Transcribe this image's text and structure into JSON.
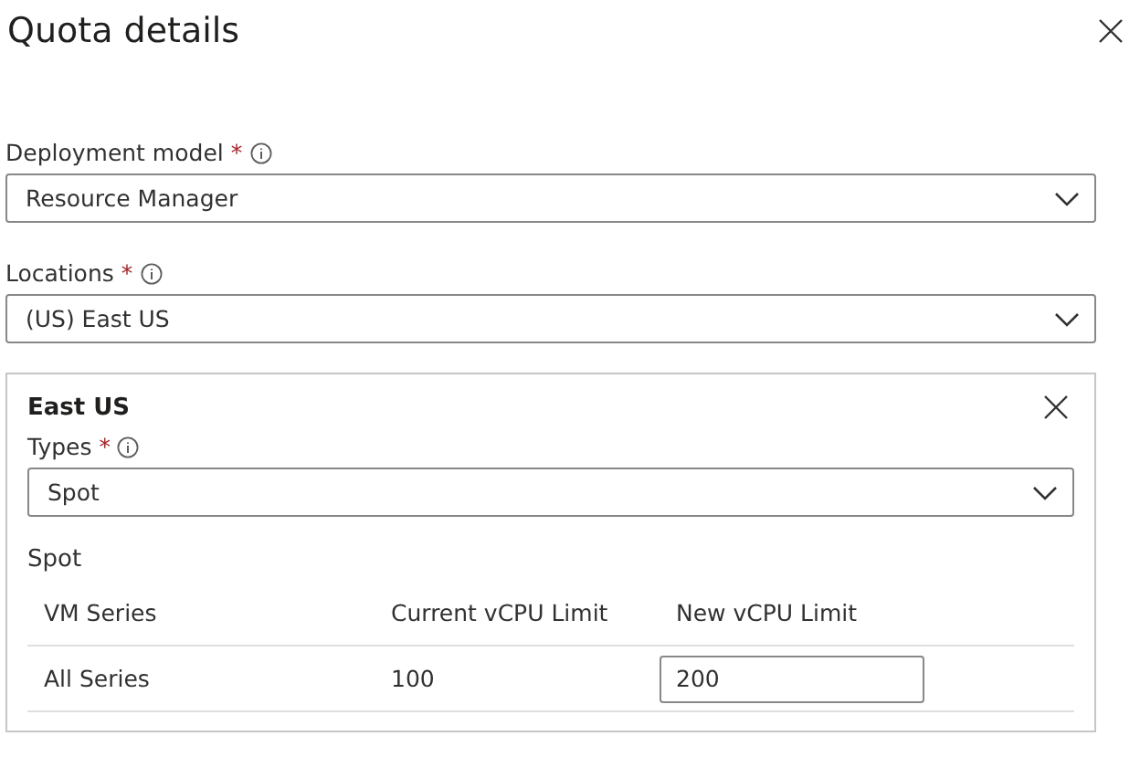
{
  "panel": {
    "title": "Quota details"
  },
  "fields": [
    {
      "label": "Deployment model",
      "required_mark": "*",
      "value": "Resource Manager"
    },
    {
      "label": "Locations",
      "required_mark": "*",
      "value": "(US) East US"
    }
  ],
  "region": {
    "title": "East US",
    "types": {
      "label": "Types",
      "required_mark": "*",
      "value": "Spot"
    },
    "section_title": "Spot",
    "table": {
      "columns": [
        "VM Series",
        "Current vCPU Limit",
        "New vCPU Limit"
      ],
      "rows": [
        {
          "series": "All Series",
          "current": "100",
          "new_limit": "200"
        }
      ]
    }
  }
}
